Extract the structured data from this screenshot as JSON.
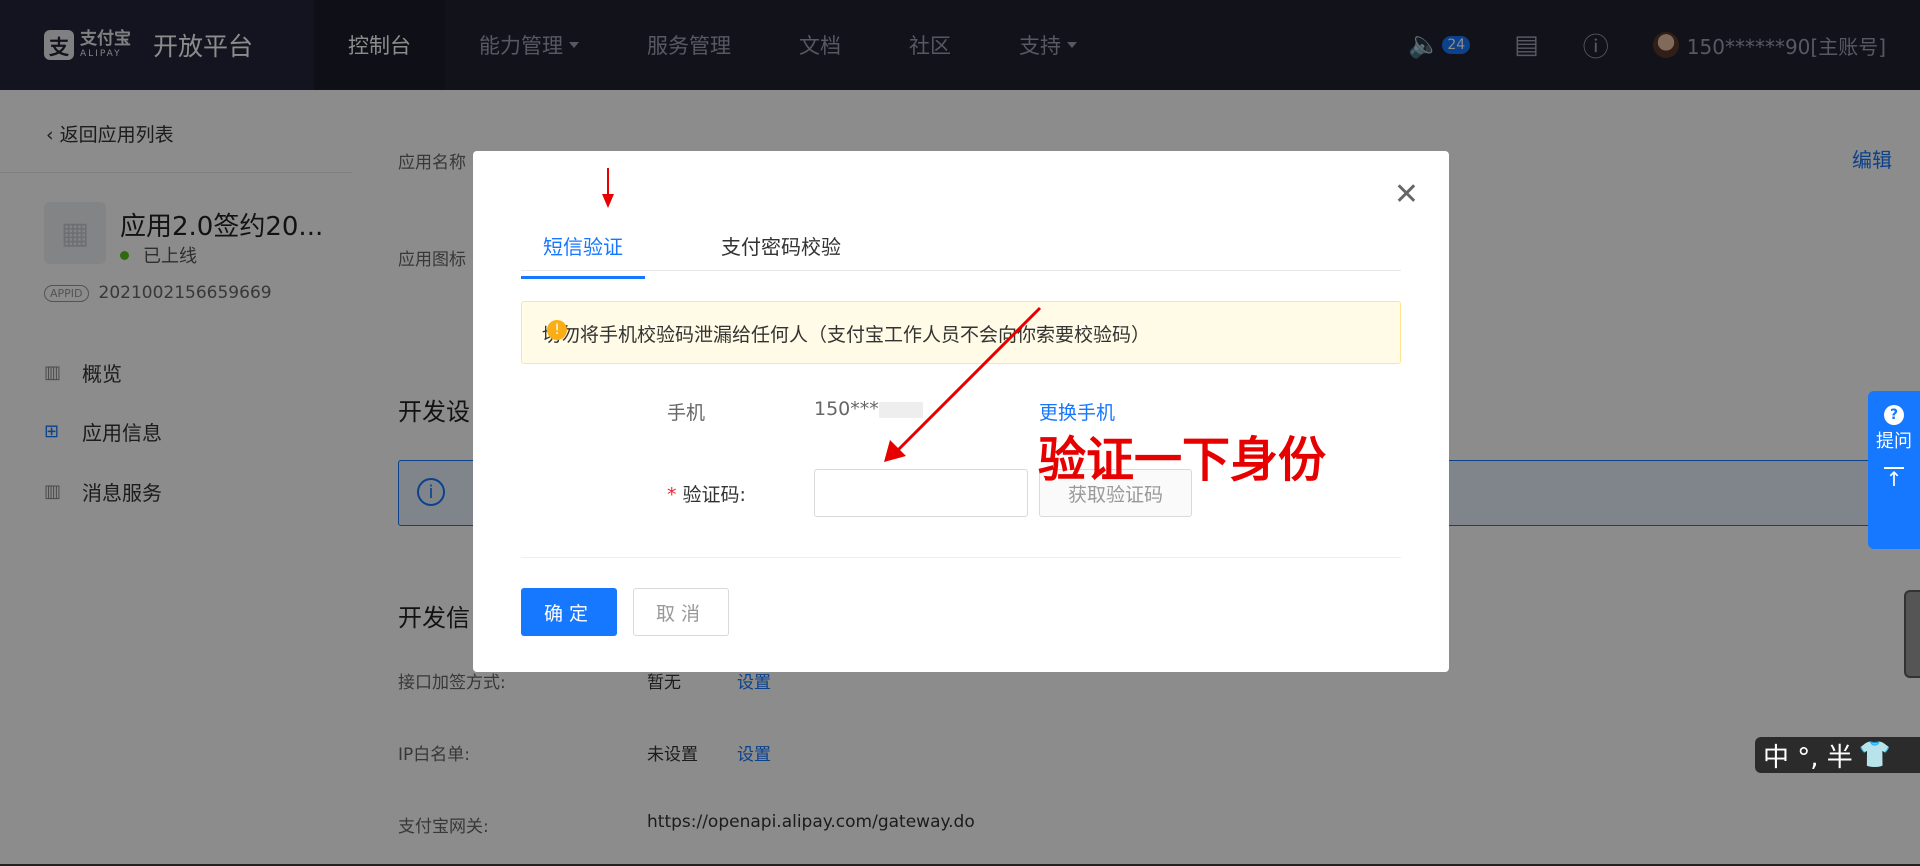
{
  "topbar": {
    "logo_cn": "支付宝",
    "logo_en": "ALIPAY",
    "platform": "开放平台",
    "nav": [
      "控制台",
      "能力管理",
      "服务管理",
      "文档",
      "社区",
      "支持"
    ],
    "notify_count": "24",
    "account": "150******90[主账号]"
  },
  "sidebar": {
    "back": "返回应用列表",
    "app_name": "应用2.0签约20...",
    "app_status": "已上线",
    "appid_tag": "APPID",
    "appid": "2021002156659669",
    "menu": [
      "概览",
      "应用信息",
      "消息服务"
    ]
  },
  "main": {
    "app_name_label": "应用名称",
    "edit": "编辑",
    "app_icon_label": "应用图标",
    "dev_settings": "开发设",
    "dev_info": "开发信",
    "sign_label": "接口加签方式:",
    "sign_value": "暂无",
    "sign_link": "设置",
    "ip_label": "IP白名单:",
    "ip_value": "未设置",
    "ip_link": "设置",
    "gateway_label": "支付宝网关:",
    "gateway_value": "https://openapi.alipay.com/gateway.do"
  },
  "modal": {
    "tabs": [
      "短信验证",
      "支付密码校验"
    ],
    "warning": "切勿将手机校验码泄漏给任何人（支付宝工作人员不会向你索要校验码）",
    "phone_label": "手机",
    "phone_value": "150***",
    "change_phone": "更换手机",
    "code_label": "验证码:",
    "get_code": "获取验证码",
    "ok": "确定",
    "cancel": "取消"
  },
  "annotation": "验证一下身份",
  "float": {
    "ask": "提问",
    "ime": "中 °, 半"
  },
  "colors": {
    "accent": "#1677ff",
    "topbar": "#1f2130",
    "annotation": "#e60000"
  }
}
